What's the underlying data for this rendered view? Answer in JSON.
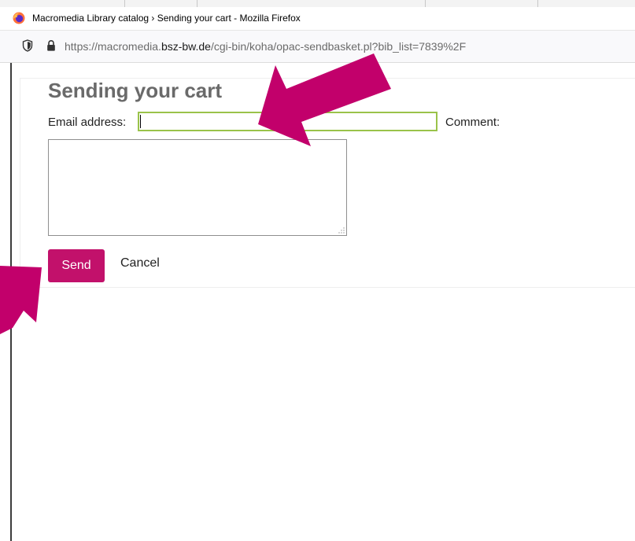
{
  "window": {
    "title": "Macromedia Library catalog › Sending your cart - Mozilla Firefox",
    "url_prefix": "https://macromedia.",
    "url_domain": "bsz-bw.de",
    "url_path": "/cgi-bin/koha/opac-sendbasket.pl?bib_list=7839%2F"
  },
  "form": {
    "heading": "Sending your cart",
    "email_label": "Email address:",
    "email_value": "",
    "comment_label": "Comment:",
    "comment_value": "",
    "send_label": "Send",
    "cancel_label": "Cancel"
  },
  "colors": {
    "accent": "#c2116b",
    "focus_border": "#9ac34a",
    "heading": "#6a6a6a"
  },
  "icons": {
    "browser": "firefox-icon",
    "tracking": "shield-icon",
    "secure": "lock-icon"
  }
}
